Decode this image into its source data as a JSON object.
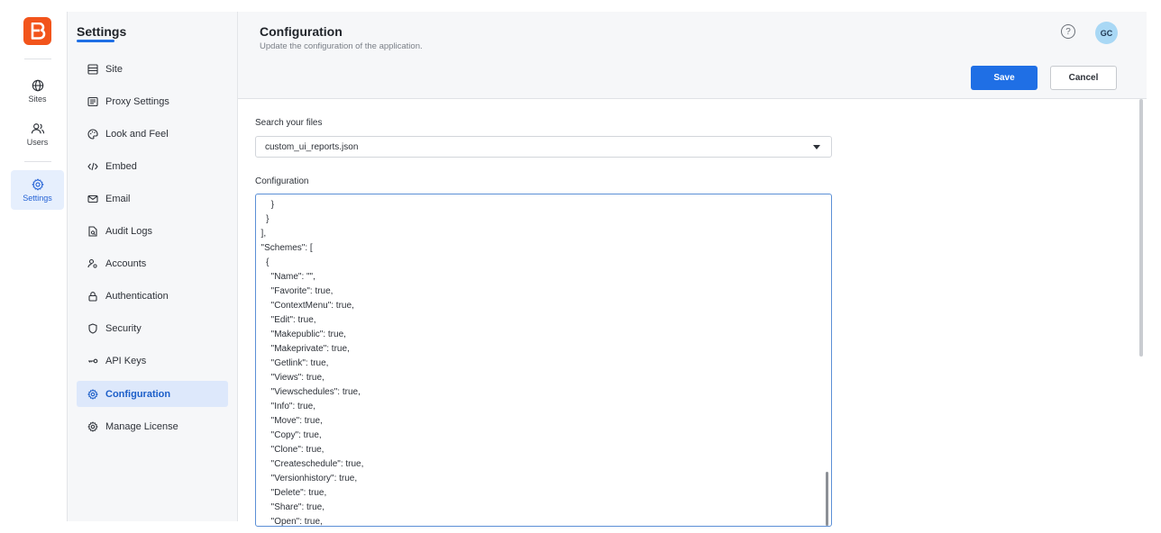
{
  "rail": {
    "items": [
      {
        "label": "Sites",
        "icon": "globe-icon"
      },
      {
        "label": "Users",
        "icon": "users-icon"
      },
      {
        "label": "Settings",
        "icon": "gear-icon"
      }
    ],
    "brand_color": "#f2541b"
  },
  "sidebar": {
    "title": "Settings",
    "items": [
      {
        "label": "Site",
        "icon": "site-icon"
      },
      {
        "label": "Proxy Settings",
        "icon": "proxy-icon"
      },
      {
        "label": "Look and Feel",
        "icon": "palette-icon"
      },
      {
        "label": "Embed",
        "icon": "code-icon"
      },
      {
        "label": "Email",
        "icon": "mail-icon"
      },
      {
        "label": "Audit Logs",
        "icon": "audit-icon"
      },
      {
        "label": "Accounts",
        "icon": "accounts-icon"
      },
      {
        "label": "Authentication",
        "icon": "lock-icon"
      },
      {
        "label": "Security",
        "icon": "shield-icon"
      },
      {
        "label": "API Keys",
        "icon": "key-icon"
      },
      {
        "label": "Configuration",
        "icon": "gear-icon",
        "active": true
      },
      {
        "label": "Manage License",
        "icon": "license-icon"
      }
    ]
  },
  "header": {
    "title": "Configuration",
    "subtitle": "Update the configuration of the application.",
    "help_glyph": "?",
    "avatar_initials": "GC",
    "save_label": "Save",
    "cancel_label": "Cancel",
    "accent_color": "#1f6fe5"
  },
  "search": {
    "label": "Search your files",
    "selected": "custom_ui_reports.json"
  },
  "config": {
    "label": "Configuration",
    "lines": [
      "      }",
      "    }",
      "  ],",
      "  \"Schemes\": [",
      "    {",
      "      \"Name\": \"\",",
      "      \"Favorite\": true,",
      "      \"ContextMenu\": true,",
      "      \"Edit\": true,",
      "      \"Makepublic\": true,",
      "      \"Makeprivate\": true,",
      "      \"Getlink\": true,",
      "      \"Views\": true,",
      "      \"Viewschedules\": true,",
      "      \"Info\": true,",
      "      \"Move\": true,",
      "      \"Copy\": true,",
      "      \"Clone\": true,",
      "      \"Createschedule\": true,",
      "      \"Versionhistory\": true,",
      "      \"Delete\": true,",
      "      \"Share\": true,",
      "      \"Open\": true,"
    ]
  }
}
